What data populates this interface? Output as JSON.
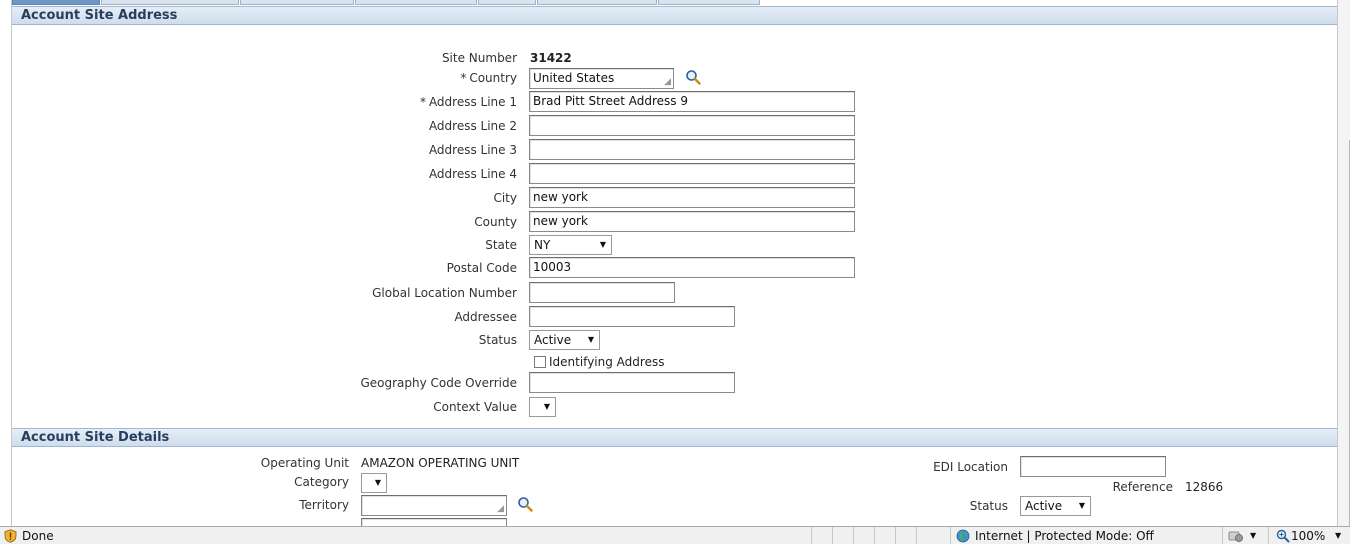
{
  "address_section": {
    "title": "Account Site Address",
    "site_number_label": "Site Number",
    "site_number": "31422",
    "country_label": "Country",
    "country_value": "United States",
    "address1_label": "Address Line 1",
    "address1_value": "Brad Pitt Street Address 9",
    "address2_label": "Address Line 2",
    "address2_value": "",
    "address3_label": "Address Line 3",
    "address3_value": "",
    "address4_label": "Address Line 4",
    "address4_value": "",
    "city_label": "City",
    "city_value": "new york",
    "county_label": "County",
    "county_value": "new york",
    "state_label": "State",
    "state_value": "NY",
    "postal_label": "Postal Code",
    "postal_value": "10003",
    "gln_label": "Global Location Number",
    "gln_value": "",
    "addressee_label": "Addressee",
    "addressee_value": "",
    "status_label": "Status",
    "status_value": "Active",
    "identifying_label": "Identifying Address",
    "geo_label": "Geography Code Override",
    "geo_value": "",
    "context_label": "Context Value",
    "context_value": ""
  },
  "details_section": {
    "title": "Account Site Details",
    "operating_unit_label": "Operating Unit",
    "operating_unit_value": "AMAZON OPERATING UNIT",
    "category_label": "Category",
    "category_value": "",
    "territory_label": "Territory",
    "territory_value": "",
    "edi_label": "EDI Location",
    "edi_value": "",
    "reference_label": "Reference",
    "reference_value": "12866",
    "status_label": "Status",
    "status_value": "Active"
  },
  "statusbar": {
    "done": "Done",
    "zone": "Internet | Protected Mode: Off",
    "zoom": "100%"
  },
  "colors": {
    "section_header": "#d6e2f0",
    "header_text": "#273f5c",
    "active_tab": "#6f97c3"
  }
}
